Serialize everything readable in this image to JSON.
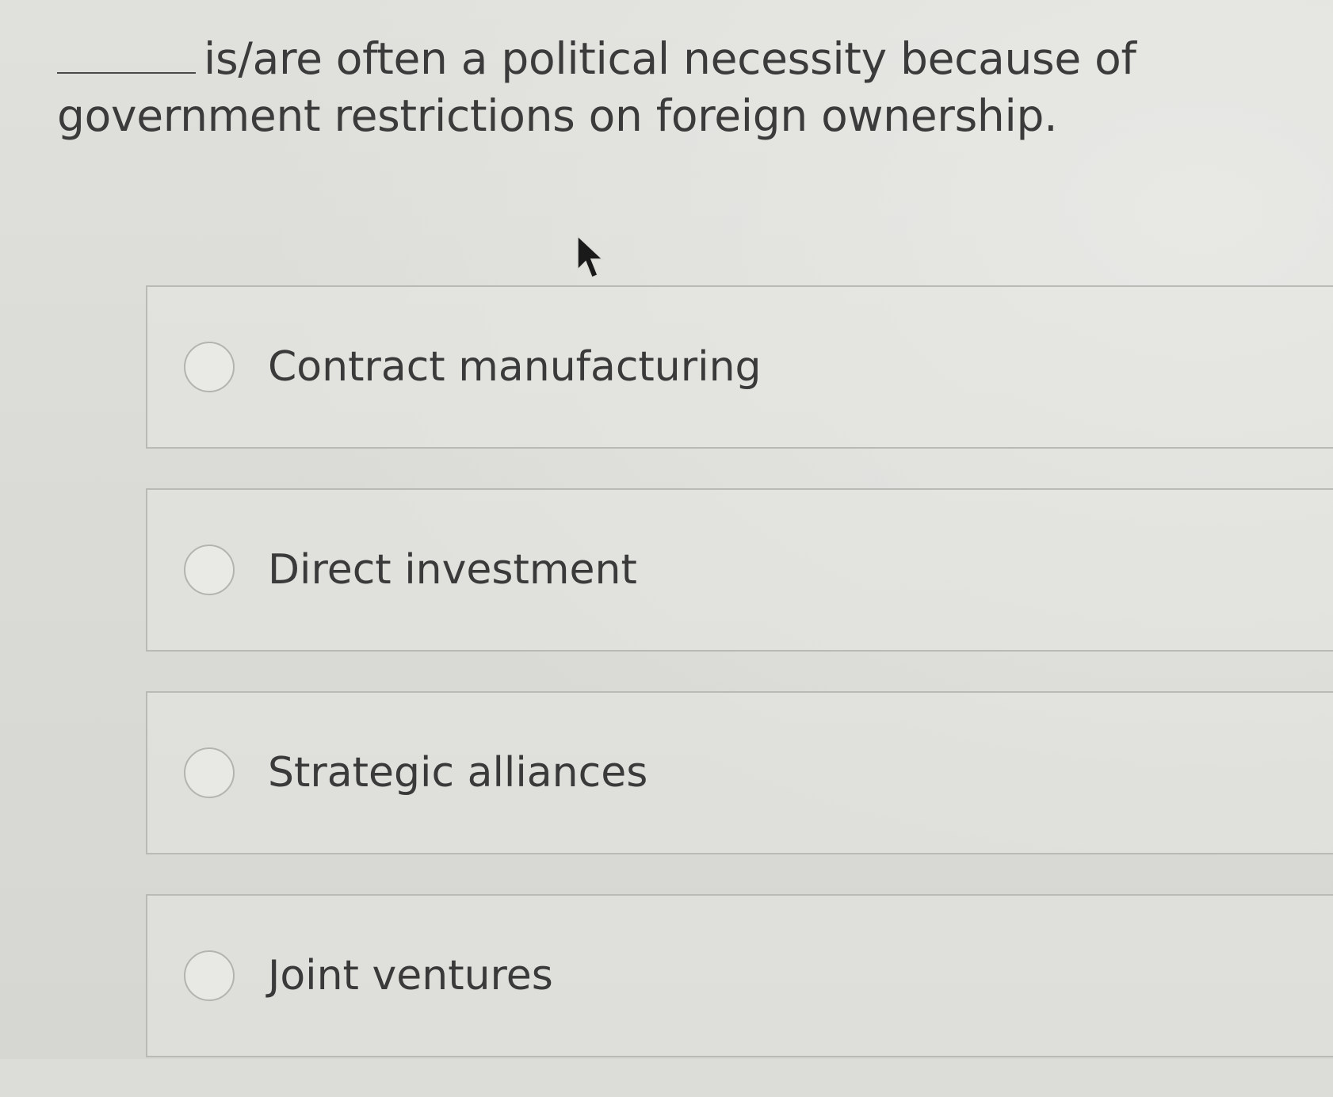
{
  "question": {
    "text": "is/are often a political necessity because of government restrictions on foreign ownership."
  },
  "options": [
    {
      "label": "Contract manufacturing"
    },
    {
      "label": "Direct investment"
    },
    {
      "label": "Strategic alliances"
    },
    {
      "label": "Joint ventures"
    }
  ],
  "icons": {
    "cursor": "mouse-pointer-icon",
    "radio": "radio-unchecked-icon"
  }
}
